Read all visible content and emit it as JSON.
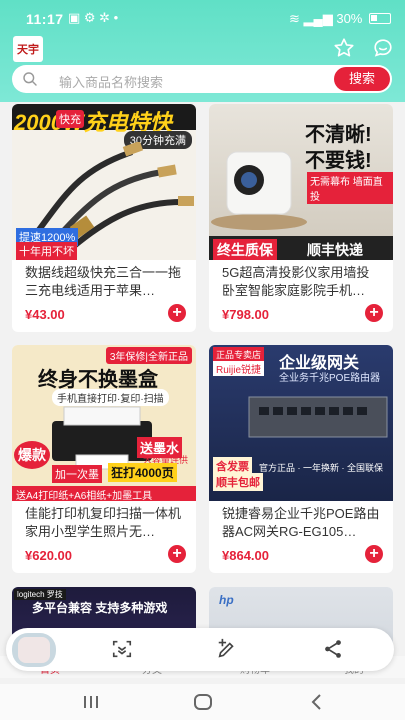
{
  "status_bar": {
    "time": "11:17",
    "battery": "30%"
  },
  "header": {
    "logo_text": "天宇"
  },
  "search": {
    "placeholder": "输入商品名称搜索",
    "button_label": "搜索"
  },
  "products": [
    {
      "name": "数据线超级快充三合一一拖三充电线适用于苹果…",
      "price": "¥43.00",
      "img": {
        "headline": "2000W充电特快",
        "tag": "快充",
        "sub": "30分钟充满",
        "badge1": "提速1200%",
        "badge2": "十年用不坏"
      }
    },
    {
      "name": "5G超高清投影仪家用墙投卧室智能家庭影院手机…",
      "price": "¥798.00",
      "img": {
        "headline1": "不清晰!",
        "headline2": "不要钱!",
        "sub": "无需幕布 墙面直投",
        "badge1": "终生质保",
        "badge2": "顺丰快递"
      }
    },
    {
      "name": "佳能打印机复印扫描一体机家用小型学生照片无…",
      "price": "¥620.00",
      "img": {
        "tag": "3年保修|全新正品",
        "headline": "终身不换墨盒",
        "sub": "手机直接打印·复印·扫描",
        "badge1": "爆款",
        "badge2": "送墨水",
        "badge3": "加一次墨",
        "badge4": "狂打4000页",
        "badge5": "大容量连供",
        "footer": "送A4打印纸+A6相纸+加墨工具"
      }
    },
    {
      "name": "锐捷睿易企业千兆POE路由器AC网关RG-EG105…",
      "price": "¥864.00",
      "img": {
        "tag": "正品专卖店",
        "brand": "Ruijie锐捷",
        "headline": "企业级网关",
        "sub": "全业务千兆POE路由器",
        "badge1": "含发票",
        "badge2": "顺丰包邮",
        "footer": "官方正品 · 一年换新 · 全国联保"
      }
    },
    {
      "name": "",
      "price": "",
      "img": {
        "brand": "logitech 罗技",
        "headline": "多平台兼容 支持多种游戏"
      }
    },
    {
      "name": "",
      "price": "",
      "img": {
        "brand": "hp"
      }
    }
  ],
  "tabs": [
    "首页",
    "分类",
    "购物车",
    "我的"
  ],
  "colors": {
    "accent": "#e5223a",
    "header": "#66e2c9"
  }
}
